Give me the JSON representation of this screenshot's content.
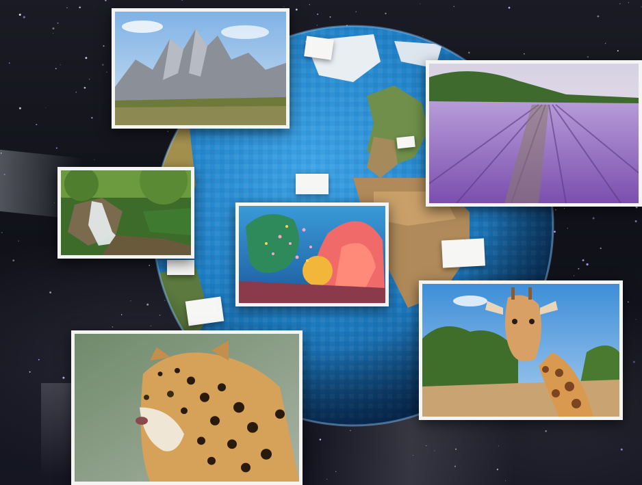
{
  "scene": {
    "description_free": true,
    "photos": [
      {
        "subject": "mountain-peaks"
      },
      {
        "subject": "lavender-field"
      },
      {
        "subject": "waterfall-forest"
      },
      {
        "subject": "coral-reef"
      },
      {
        "subject": "giraffe"
      },
      {
        "subject": "jaguar"
      }
    ],
    "colors": {
      "space": "#101119",
      "ocean": "#1f7fc4",
      "frame": "#f4f4f2",
      "lavender": "#9a6fc4",
      "coral": "#f06a6a"
    }
  }
}
